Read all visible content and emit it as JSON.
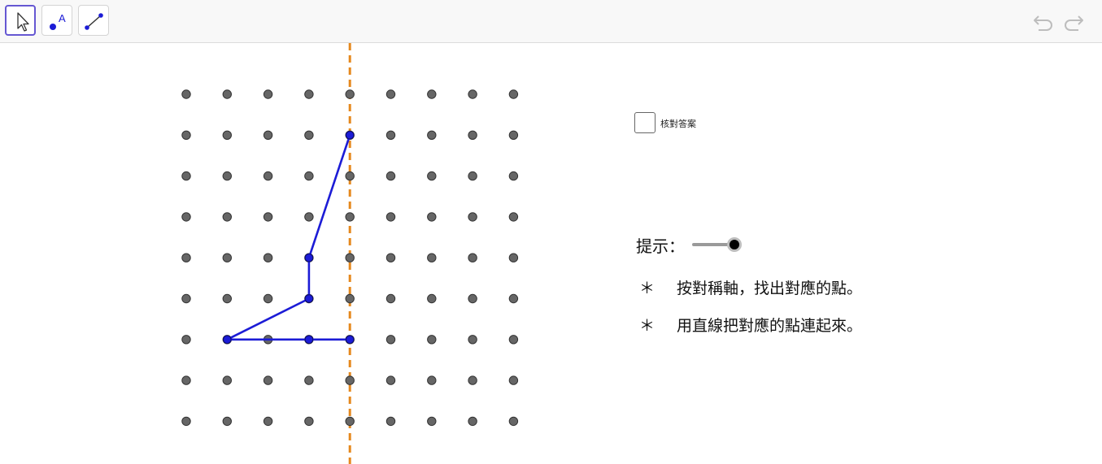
{
  "toolbar": {
    "tools": [
      {
        "name": "move-tool",
        "icon": "arrow-cursor-icon",
        "active": true
      },
      {
        "name": "point-tool",
        "icon": "point-icon",
        "glyph": "A",
        "active": false
      },
      {
        "name": "segment-tool",
        "icon": "segment-icon",
        "active": false
      }
    ],
    "undo_icon": "undo-icon",
    "redo_icon": "redo-icon"
  },
  "panel": {
    "check_answer_label": "核對答案",
    "check_answer_checked": false,
    "hint_label": "提示：",
    "hint_slider_value": 1,
    "instructions": [
      {
        "bullet": "＊",
        "text": "按對稱軸，找出對應的點。"
      },
      {
        "bullet": "＊",
        "text": "用直線把對應的點連起來。"
      }
    ]
  },
  "grid": {
    "columns": 9,
    "rows": 9,
    "dot_color": "#666666",
    "axis_column": 4,
    "axis_color": "#e5891e",
    "shape_color": "#1c1cd6",
    "shape_vertices": [
      [
        4,
        1
      ],
      [
        3,
        4
      ],
      [
        3,
        5
      ],
      [
        1,
        6
      ],
      [
        4,
        6
      ]
    ],
    "shape_points": [
      [
        4,
        1
      ],
      [
        3,
        4
      ],
      [
        3,
        5
      ],
      [
        1,
        6
      ],
      [
        3,
        6
      ],
      [
        4,
        6
      ]
    ]
  }
}
